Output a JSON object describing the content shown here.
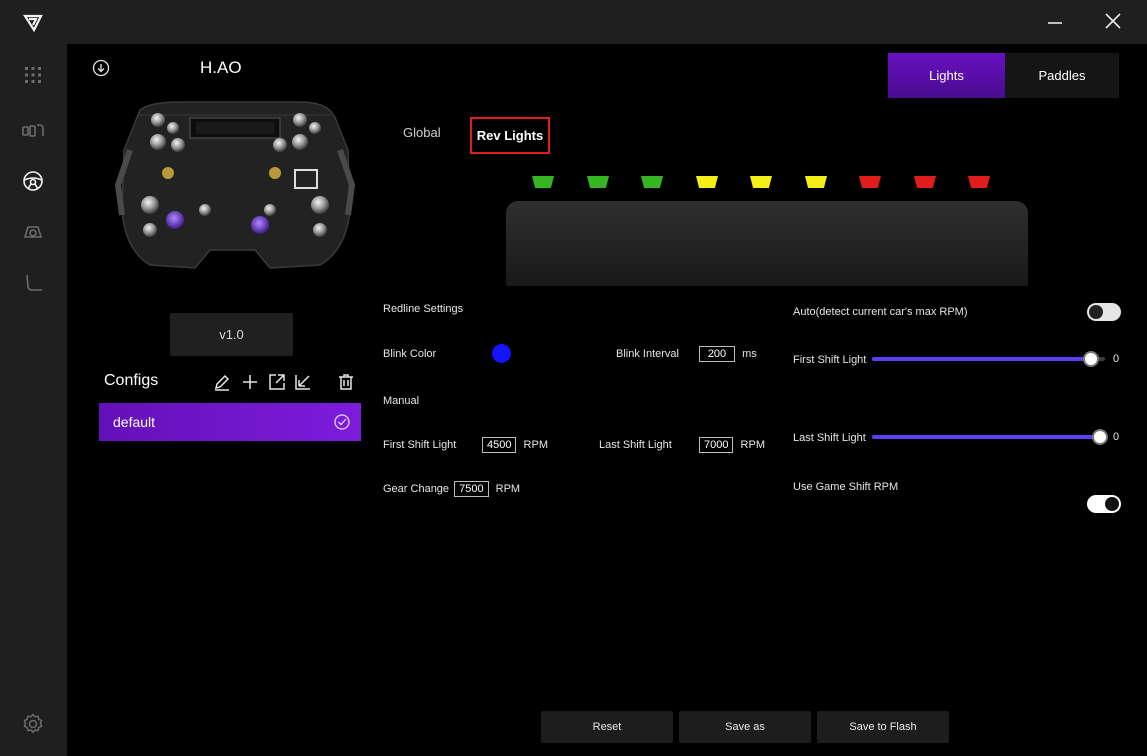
{
  "device": {
    "name": "H.AO",
    "version": "v1.0"
  },
  "configs": {
    "label": "Configs",
    "items": [
      {
        "name": "default",
        "selected": true
      }
    ]
  },
  "top_tabs": [
    {
      "label": "Lights",
      "active": true
    },
    {
      "label": "Paddles",
      "active": false
    }
  ],
  "sub_tabs": [
    {
      "label": "Global",
      "active": false
    },
    {
      "label": "Rev Lights",
      "active": true
    }
  ],
  "leds": {
    "colors": [
      "#34b521",
      "#34b521",
      "#34b521",
      "#f3ee16",
      "#f3ee16",
      "#f3ee16",
      "#e01d1d",
      "#e01d1d",
      "#e01d1d"
    ]
  },
  "redline": {
    "title": "Redline Settings",
    "blink_color_label": "Blink Color",
    "blink_color": "#1414ff",
    "blink_interval_label": "Blink Interval",
    "blink_interval_value": "200",
    "blink_interval_unit": "ms"
  },
  "manual": {
    "title": "Manual",
    "first_shift_label": "First Shift Light",
    "first_shift_value": "4500",
    "last_shift_label": "Last Shift Light",
    "last_shift_value": "7000",
    "gear_change_label": "Gear Change",
    "gear_change_value": "7500",
    "rpm_unit": "RPM"
  },
  "auto": {
    "label": "Auto(detect current car's max RPM)",
    "enabled": false,
    "first_shift_label": "First Shift Light",
    "first_shift_value": "0",
    "first_shift_fraction": 0.94,
    "last_shift_label": "Last Shift Light",
    "last_shift_value": "0",
    "last_shift_fraction": 0.98,
    "use_game_shift_label": "Use Game Shift RPM",
    "use_game_shift_enabled": true
  },
  "actions": {
    "reset": "Reset",
    "save_as": "Save as",
    "save_to_flash": "Save to Flash"
  },
  "colors": {
    "accent": "#6a12c6",
    "highlight_border": "#e21b1b"
  }
}
